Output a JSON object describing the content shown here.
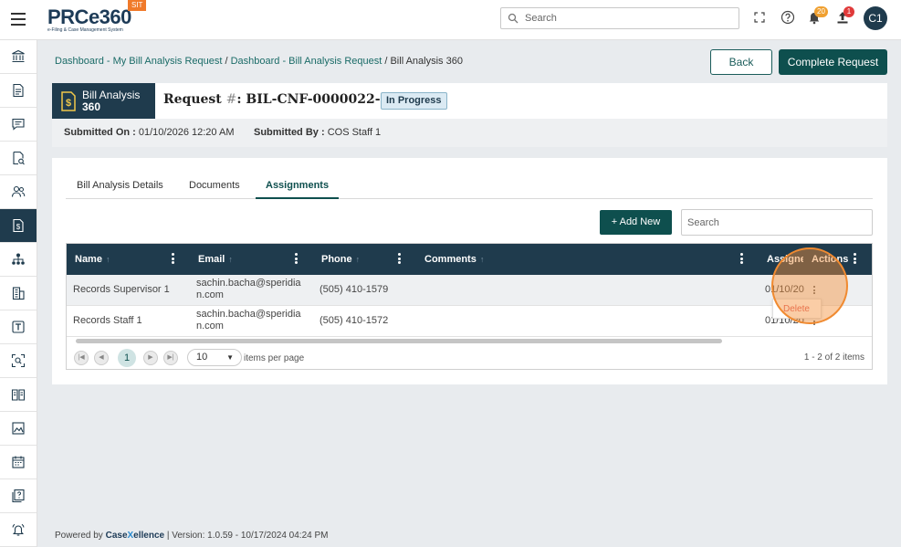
{
  "app": {
    "logo_main": "PRCe360",
    "logo_sub": "e-Filing & Case Management System",
    "env_badge": "SIT",
    "search_placeholder": "Search",
    "notifications_count": "20",
    "upload_count": "1",
    "avatar_initials": "C1",
    "icons": [
      "hamburger-icon",
      "search-icon",
      "fullscreen-icon",
      "help-icon",
      "bell-icon",
      "upload-icon"
    ]
  },
  "sidebar": {
    "items": [
      {
        "icon": "bank-icon",
        "active": false
      },
      {
        "icon": "document-icon",
        "active": false
      },
      {
        "icon": "chat-icon",
        "active": false
      },
      {
        "icon": "document-search-icon",
        "active": false
      },
      {
        "icon": "users-icon",
        "active": false
      },
      {
        "icon": "bill-dollar-icon",
        "active": true
      },
      {
        "icon": "org-chart-icon",
        "active": false
      },
      {
        "icon": "building-icon",
        "active": false
      },
      {
        "icon": "text-box-icon",
        "active": false
      },
      {
        "icon": "scan-search-icon",
        "active": false
      },
      {
        "icon": "book-icon",
        "active": false
      },
      {
        "icon": "chart-image-icon",
        "active": false
      },
      {
        "icon": "calendar-icon",
        "active": false
      },
      {
        "icon": "faq-icon",
        "active": false
      },
      {
        "icon": "alarm-bell-icon",
        "active": false
      }
    ]
  },
  "breadcrumb": {
    "item1": "Dashboard - My Bill Analysis Request",
    "sep": " / ",
    "item2": "Dashboard - Bill Analysis Request",
    "current": "Bill Analysis 360"
  },
  "actions": {
    "back": "Back",
    "complete": "Complete Request"
  },
  "header": {
    "tile_line1": "Bill Analysis",
    "tile_line2": "360",
    "request_prefix": "Request ",
    "request_hash": "#",
    "request_id": ": BIL-CNF-0000022-26",
    "status": "In Progress",
    "submitted_on_label": "Submitted On :",
    "submitted_on": "01/10/2026 12:20 AM",
    "submitted_by_label": "Submitted By :",
    "submitted_by": "COS Staff 1"
  },
  "tabs": [
    {
      "label": "Bill Analysis Details",
      "active": false
    },
    {
      "label": "Documents",
      "active": false
    },
    {
      "label": "Assignments",
      "active": true
    }
  ],
  "grid": {
    "add_button": "+ Add New",
    "search_placeholder": "Search",
    "columns": [
      "Name",
      "Email",
      "Phone",
      "Comments",
      "Assigned",
      "Actions"
    ],
    "sort_arrow": "↑",
    "rows": [
      {
        "name": "Records Supervisor 1",
        "email_line1": "sachin.bacha@speridia",
        "email_line2": "n.com",
        "phone": "(505) 410-1579",
        "comments": "",
        "assigned": "01/10/2026"
      },
      {
        "name": "Records Staff 1",
        "email_line1": "sachin.bacha@speridia",
        "email_line2": "n.com",
        "phone": "(505) 410-1572",
        "comments": "",
        "assigned": "01/10/2026"
      }
    ],
    "pager": {
      "current_page": "1",
      "page_size": "10",
      "page_size_label": "items per page",
      "count": "1 - 2 of 2 items"
    },
    "row_menu": {
      "delete": "Delete"
    }
  },
  "footer": {
    "powered_by": "Powered by",
    "brand_a": "Case",
    "brand_b": "X",
    "brand_c": "ellence",
    "version": "|  Version: 1.0.59 - 10/17/2024 04:24 PM"
  }
}
